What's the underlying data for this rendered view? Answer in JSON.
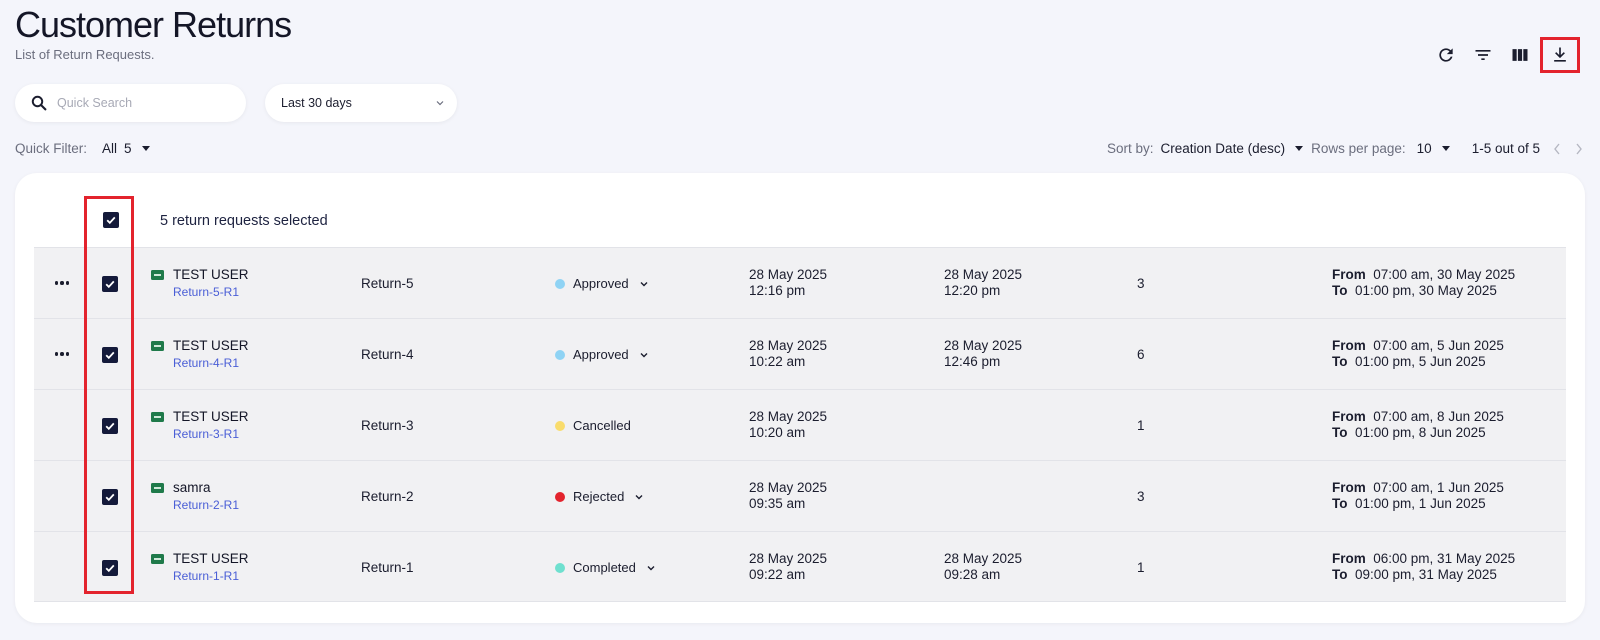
{
  "header": {
    "title": "Customer Returns",
    "subtitle": "List of Return Requests."
  },
  "toolbar": {
    "icons": [
      "refresh-icon",
      "filter-icon",
      "columns-icon",
      "download-icon"
    ]
  },
  "search": {
    "placeholder": "Quick Search",
    "value": ""
  },
  "date_filter": {
    "selected": "Last 30 days"
  },
  "quick_filter": {
    "label": "Quick Filter:",
    "value": "All",
    "count": "5"
  },
  "sort": {
    "label": "Sort by:",
    "value": "Creation Date (desc)"
  },
  "rows_per_page": {
    "label": "Rows per page:",
    "value": "10"
  },
  "pagination": {
    "text": "1-5 out of 5"
  },
  "selection": {
    "text": "5 return requests selected"
  },
  "status_colors": {
    "Approved": "#8fd3f4",
    "Cancelled": "#f9dc6c",
    "Rejected": "#e3232d",
    "Completed": "#6fe0cf"
  },
  "rows": [
    {
      "has_menu": true,
      "customer": "TEST USER",
      "return_code": "Return-5-R1",
      "return_id": "Return-5",
      "status": "Approved",
      "has_status_menu": true,
      "created_date": "28 May 2025",
      "created_time": "12:16 pm",
      "updated_date": "28 May 2025",
      "updated_time": "12:20 pm",
      "qty": "3",
      "from_label": "From",
      "from": "07:00 am, 30 May 2025",
      "to_label": "To",
      "to": "01:00 pm, 30 May 2025"
    },
    {
      "has_menu": true,
      "customer": "TEST USER",
      "return_code": "Return-4-R1",
      "return_id": "Return-4",
      "status": "Approved",
      "has_status_menu": true,
      "created_date": "28 May 2025",
      "created_time": "10:22 am",
      "updated_date": "28 May 2025",
      "updated_time": "12:46 pm",
      "qty": "6",
      "from_label": "From",
      "from": "07:00 am, 5 Jun 2025",
      "to_label": "To",
      "to": "01:00 pm, 5 Jun 2025"
    },
    {
      "has_menu": false,
      "customer": "TEST USER",
      "return_code": "Return-3-R1",
      "return_id": "Return-3",
      "status": "Cancelled",
      "has_status_menu": false,
      "created_date": "28 May 2025",
      "created_time": "10:20 am",
      "updated_date": "",
      "updated_time": "",
      "qty": "1",
      "from_label": "From",
      "from": "07:00 am, 8 Jun 2025",
      "to_label": "To",
      "to": "01:00 pm, 8 Jun 2025"
    },
    {
      "has_menu": false,
      "customer": "samra",
      "return_code": "Return-2-R1",
      "return_id": "Return-2",
      "status": "Rejected",
      "has_status_menu": true,
      "created_date": "28 May 2025",
      "created_time": "09:35 am",
      "updated_date": "",
      "updated_time": "",
      "qty": "3",
      "from_label": "From",
      "from": "07:00 am, 1 Jun 2025",
      "to_label": "To",
      "to": "01:00 pm, 1 Jun 2025"
    },
    {
      "has_menu": false,
      "customer": "TEST USER",
      "return_code": "Return-1-R1",
      "return_id": "Return-1",
      "status": "Completed",
      "has_status_menu": true,
      "created_date": "28 May 2025",
      "created_time": "09:22 am",
      "updated_date": "28 May 2025",
      "updated_time": "09:28 am",
      "qty": "1",
      "from_label": "From",
      "from": "06:00 pm, 31 May 2025",
      "to_label": "To",
      "to": "09:00 pm, 31 May 2025"
    }
  ]
}
